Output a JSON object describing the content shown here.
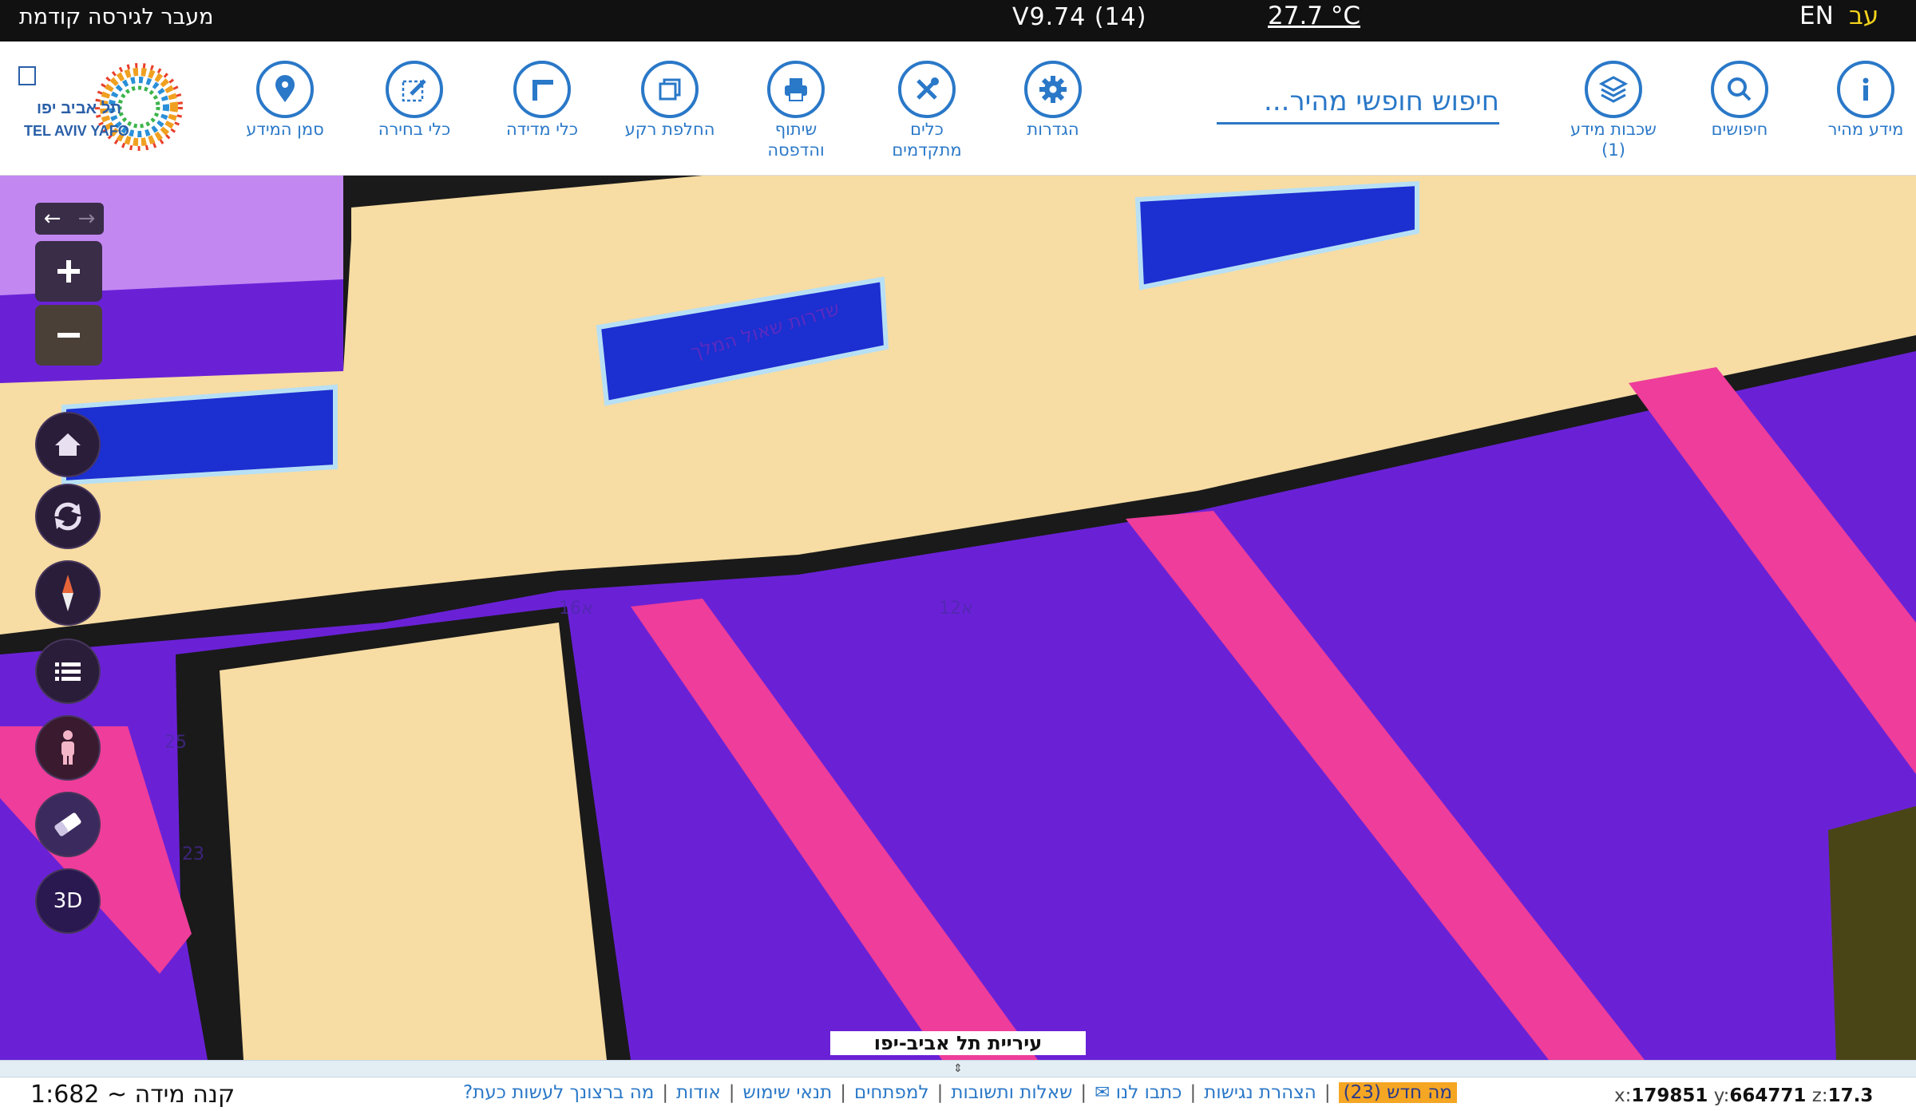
{
  "topbar": {
    "previous_version": "מעבר לגירסה קודמת",
    "version": "V9.74 (14)",
    "temperature": "27.7 °C",
    "lang_en": "EN",
    "lang_he": "עב"
  },
  "toolbar": {
    "quick_info": "מידע מהיר",
    "searches": "חיפושים",
    "layers_line1": "שכבות מידע",
    "layers_line2": "(1)",
    "search_placeholder": "חיפוש חופשי מהיר...",
    "settings": "הגדרות",
    "advanced_line1": "כלים",
    "advanced_line2": "מתקדמים",
    "share_line1": "שיתוף",
    "share_line2": "והדפסה",
    "basemap": "החלפת רקע",
    "measure": "כלי מדידה",
    "select": "כלי בחירה",
    "marker": "סמן המידע",
    "logo_he": "תל אביב יפו",
    "logo_en": "TEL AVIV YAFO"
  },
  "map": {
    "street_label": "שדרות שאול המלך",
    "number_16": "16א",
    "number_12": "12א",
    "number_25": "25",
    "number_23": "23",
    "city_label": "עיריית תל אביב-יפו",
    "control_3d": "3D"
  },
  "footer": {
    "scale": "קנה מידה ~ 1:682",
    "links": [
      "מה ברצונך לעשות כעת?",
      "אודות",
      "תנאי שימוש",
      "למפתחים",
      "שאלות ותשובות",
      "כתבו לנו ✉",
      "הצהרת נגישות"
    ],
    "whats_new": "מה חדש (23)",
    "coord_x_label": "x:",
    "coord_x": "179851",
    "coord_y_label": "y:",
    "coord_y": "664771",
    "coord_z_label": "z:",
    "coord_z": "17.3"
  },
  "colors": {
    "accent": "#2a78c8",
    "road": "#f7dca3",
    "zone_purple": "#6a21d6",
    "zone_pink": "#ee3d9a",
    "zone_blue": "#1c2fd0",
    "zone_lilac": "#c387f2",
    "zone_olive": "#4a4516"
  }
}
